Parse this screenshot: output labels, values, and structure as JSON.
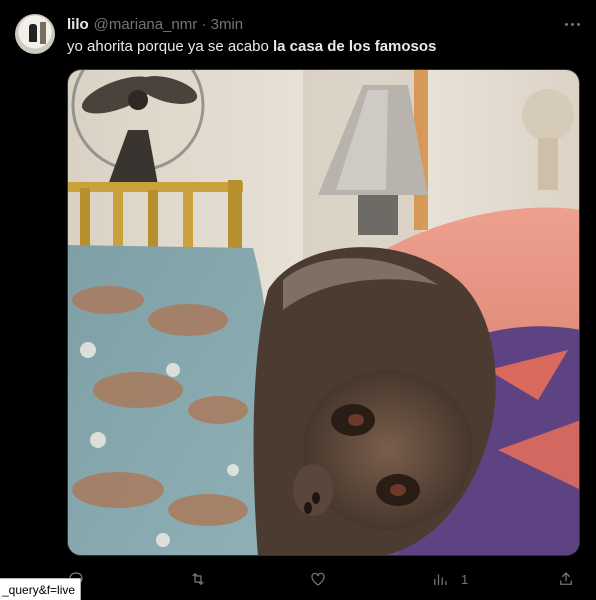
{
  "tweet": {
    "display_name": "lilo",
    "handle_time": "@mariana_nmr · 3min",
    "text_plain": "yo ahorita porque ya se acabo ",
    "text_bold": "la casa de los famosos",
    "actions": {
      "views_count": "1"
    }
  },
  "media": {
    "description_icon": "monkey-photo"
  },
  "status_url": "_query&f=live"
}
